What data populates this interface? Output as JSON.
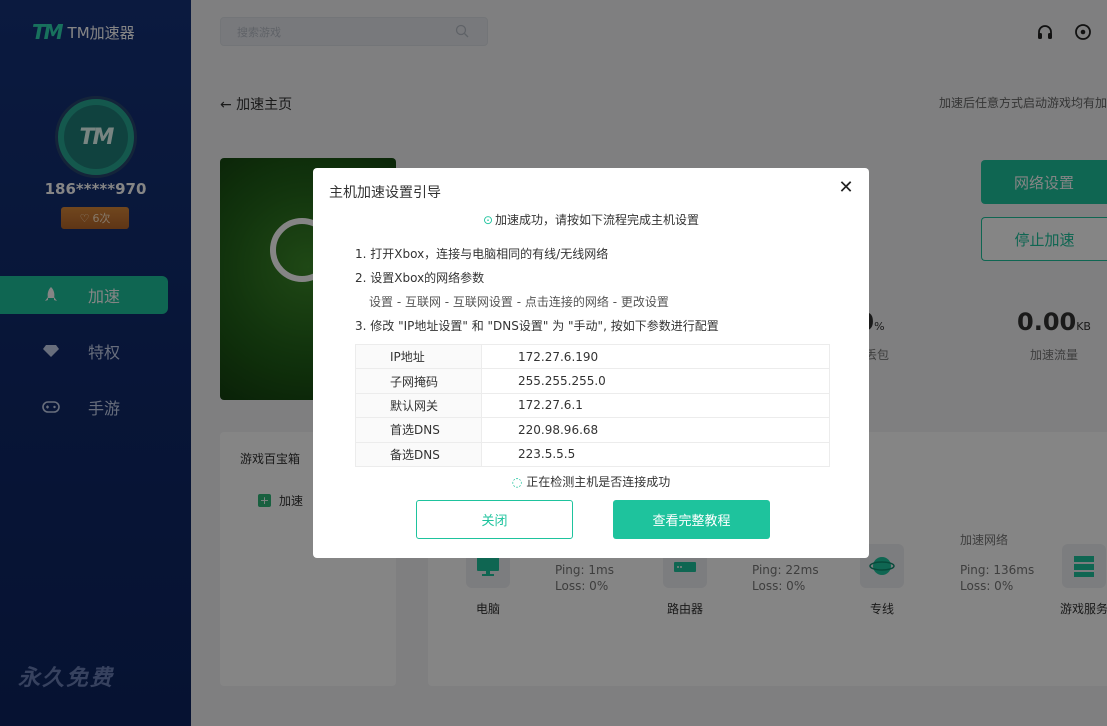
{
  "app": {
    "logo_text": "TM",
    "name": "TM加速器"
  },
  "user": {
    "avatar_text": "TM",
    "phone": "186*****970",
    "badge": "6次"
  },
  "nav": [
    {
      "label": "加速"
    },
    {
      "label": "特权"
    },
    {
      "label": "手游"
    }
  ],
  "sidebar_footer": "永久免费",
  "search": {
    "placeholder": "搜索游戏"
  },
  "back_label": "← 加速主页",
  "top_note": "加速后任意方式启动游戏均有加",
  "buttons": {
    "network_settings": "网络设置",
    "stop_accel": "停止加速"
  },
  "stats": [
    {
      "value": "0",
      "unit": "%",
      "label": "时丢包"
    },
    {
      "value": "0.00",
      "unit": "KB",
      "label": "加速流量"
    }
  ],
  "lower": {
    "title": "游戏百宝箱",
    "item": "加速"
  },
  "nodes": [
    {
      "label": "电脑"
    },
    {
      "label": "路由器"
    },
    {
      "label": "专线"
    },
    {
      "label": "游戏服务"
    }
  ],
  "pings": [
    {
      "ping": "Ping: 1ms",
      "loss": "Loss: 0%"
    },
    {
      "ping": "Ping: 22ms",
      "loss": "Loss: 0%"
    },
    {
      "title": "加速网络",
      "ping": "Ping: 136ms",
      "loss": "Loss: 0%"
    }
  ],
  "dialog": {
    "title": "主机加速设置引导",
    "success": "加速成功，请按如下流程完成主机设置",
    "steps": [
      "1. 打开Xbox，连接与电脑相同的有线/无线网络",
      "2. 设置Xbox的网络参数",
      "设置 - 互联网 - 互联网设置 - 点击连接的网络 - 更改设置",
      "3. 修改 \"IP地址设置\" 和 \"DNS设置\" 为 \"手动\", 按如下参数进行配置"
    ],
    "params": [
      {
        "key": "IP地址",
        "value": "172.27.6.190"
      },
      {
        "key": "子网掩码",
        "value": "255.255.255.0"
      },
      {
        "key": "默认网关",
        "value": "172.27.6.1"
      },
      {
        "key": "首选DNS",
        "value": "220.98.96.68"
      },
      {
        "key": "备选DNS",
        "value": "223.5.5.5"
      }
    ],
    "checking": "正在检测主机是否连接成功",
    "close_label": "关闭",
    "tutorial_label": "查看完整教程"
  },
  "colors": {
    "accent": "#1ec39d",
    "sidebar": "#13307a"
  }
}
